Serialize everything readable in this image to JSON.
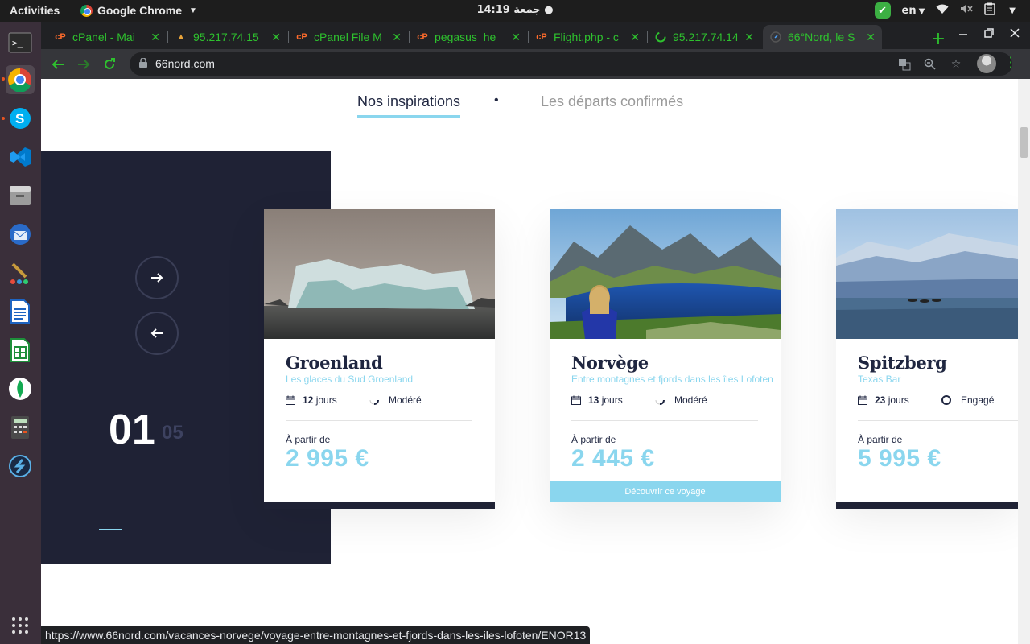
{
  "system": {
    "activities": "Activities",
    "app_name": "Google Chrome",
    "clock": "جمعة 14:19",
    "language": "en"
  },
  "browser": {
    "tabs": [
      {
        "title": "cPanel - Mai",
        "favicon": "cpanel-icon"
      },
      {
        "title": "95.217.74.15",
        "favicon": "warning-icon"
      },
      {
        "title": "cPanel File M",
        "favicon": "cpanel-icon"
      },
      {
        "title": "pegasus_he",
        "favicon": "cpanel-icon"
      },
      {
        "title": "Flight.php - c",
        "favicon": "cpanel-icon"
      },
      {
        "title": "95.217.74.14",
        "favicon": "loading-icon"
      },
      {
        "title": "66°Nord, le S",
        "favicon": "compass-icon",
        "active": true
      }
    ],
    "url": "66nord.com",
    "status_url": "https://www.66nord.com/vacances-norvege/voyage-entre-montagnes-et-fjords-dans-les-iles-lofoten/ENOR13"
  },
  "page": {
    "subnav": {
      "active": "Nos inspirations",
      "separator": "•",
      "inactive": "Les départs confirmés"
    },
    "slider": {
      "current": "01",
      "total": "05",
      "progress": 0.2
    },
    "cards": [
      {
        "name": "Groenland",
        "tagline": "Les glaces du Sud Groenland",
        "days_num": "12",
        "days_unit": "jours",
        "level": "Modéré",
        "from_label": "À partir de",
        "price": "2 995 €"
      },
      {
        "name": "Norvège",
        "tagline": "Entre montagnes et fjords dans les îles Lofoten",
        "days_num": "13",
        "days_unit": "jours",
        "level": "Modéré",
        "from_label": "À partir de",
        "price": "2 445 €",
        "cta": "Découvrir ce voyage"
      },
      {
        "name": "Spitzberg",
        "tagline": "Texas Bar",
        "days_num": "23",
        "days_unit": "jours",
        "level": "Engagé",
        "from_label": "À partir de",
        "price": "5 995 €"
      }
    ]
  },
  "colors": {
    "accent": "#8ad6ee",
    "navy": "#1f2235",
    "tab_text": "#2ec12e"
  }
}
